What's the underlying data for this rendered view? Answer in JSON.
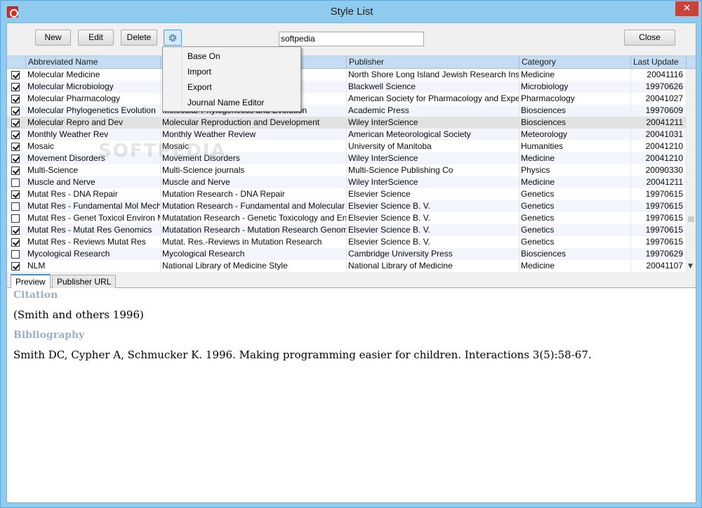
{
  "window": {
    "title": "Style List"
  },
  "toolbar": {
    "new_label": "New",
    "edit_label": "Edit",
    "delete_label": "Delete",
    "search_value": "softpedia",
    "close_label": "Close"
  },
  "menu": {
    "items": [
      "Base On",
      "Import",
      "Export",
      "Journal Name Editor"
    ]
  },
  "table": {
    "columns": [
      "Abbreviated Name",
      "",
      "Publisher",
      "Category",
      "Last Update"
    ],
    "rows": [
      {
        "checked": true,
        "abbr": "Molecular Medicine",
        "full": "",
        "publisher": "North Shore Long Island Jewish Research Instit...",
        "category": "Medicine",
        "updated": "20041116"
      },
      {
        "checked": true,
        "abbr": "Molecular Microbiology",
        "full": "",
        "publisher": "Blackwell Science",
        "category": "Microbiology",
        "updated": "19970626"
      },
      {
        "checked": true,
        "abbr": "Molecular Pharmacology",
        "full": "",
        "publisher": "American Society for Pharmacology and Experi...",
        "category": "Pharmacology",
        "updated": "20041027"
      },
      {
        "checked": true,
        "abbr": "Molecular Phylogenetics Evolution",
        "full": "Molecular Phylogenetics and Evolution",
        "publisher": "Academic Press",
        "category": "Biosciences",
        "updated": "19970609"
      },
      {
        "checked": true,
        "abbr": "Molecular Repro and Dev",
        "full": "Molecular Reproduction and Development",
        "publisher": "Wiley InterScience",
        "category": "Biosciences",
        "updated": "20041211"
      },
      {
        "checked": true,
        "abbr": "Monthly Weather Rev",
        "full": "Monthly Weather Review",
        "publisher": "American Meteorological Society",
        "category": "Meteorology",
        "updated": "20041031"
      },
      {
        "checked": true,
        "abbr": "Mosaic",
        "full": "Mosaic",
        "publisher": "University of Manitoba",
        "category": "Humanities",
        "updated": "20041210"
      },
      {
        "checked": true,
        "abbr": "Movement Disorders",
        "full": "Movement Disorders",
        "publisher": "Wiley InterScience",
        "category": "Medicine",
        "updated": "20041210"
      },
      {
        "checked": true,
        "abbr": "Multi-Science",
        "full": "Multi-Science journals",
        "publisher": "Multi-Science Publishing Co",
        "category": "Physics",
        "updated": "20090330"
      },
      {
        "checked": false,
        "abbr": "Muscle and Nerve",
        "full": "Muscle and Nerve",
        "publisher": "Wiley InterScience",
        "category": "Medicine",
        "updated": "20041211"
      },
      {
        "checked": true,
        "abbr": "Mutat Res - DNA Repair",
        "full": "Mutation Research - DNA Repair",
        "publisher": "Elsevier Science",
        "category": "Genetics",
        "updated": "19970615"
      },
      {
        "checked": false,
        "abbr": "Mutat Res - Fundamental Mol Mech ...",
        "full": "Mutation Research - Fundamental and Molecular Me...",
        "publisher": "Elsevier Science B. V.",
        "category": "Genetics",
        "updated": "19970615"
      },
      {
        "checked": false,
        "abbr": "Mutat Res - Genet Toxicol Environ Mut",
        "full": "Mutatation Research - Genetic Toxicology and Envir...",
        "publisher": "Elsevier Science B. V.",
        "category": "Genetics",
        "updated": "19970615"
      },
      {
        "checked": true,
        "abbr": "Mutat Res - Mutat Res Genomics",
        "full": "Mutatation Research -  Mutation Research Genomics",
        "publisher": "Elsevier Science B. V.",
        "category": "Genetics",
        "updated": "19970615"
      },
      {
        "checked": true,
        "abbr": "Mutat Res - Reviews Mutat Res",
        "full": "Mutat. Res.-Reviews in Mutation Research",
        "publisher": "Elsevier Science B. V.",
        "category": "Genetics",
        "updated": "19970615"
      },
      {
        "checked": false,
        "abbr": "Mycological Research",
        "full": "Mycological Research",
        "publisher": "Cambridge University Press",
        "category": "Biosciences",
        "updated": "19970629"
      },
      {
        "checked": true,
        "abbr": "NLM",
        "full": "National Library of Medicine Style",
        "publisher": "National Library of Medicine",
        "category": "Medicine",
        "updated": "20041107"
      }
    ]
  },
  "tabs": [
    "Preview",
    "Publisher URL"
  ],
  "preview": {
    "citation_heading": "Citation",
    "citation_text": "(Smith and others 1996)",
    "bibliography_heading": "Bibliography",
    "bibliography_text": "Smith DC, Cypher A, Schmucker K. 1996. Making programming easier for children. Interactions 3(5):58-67."
  },
  "watermark": "SOFTPEDIA"
}
